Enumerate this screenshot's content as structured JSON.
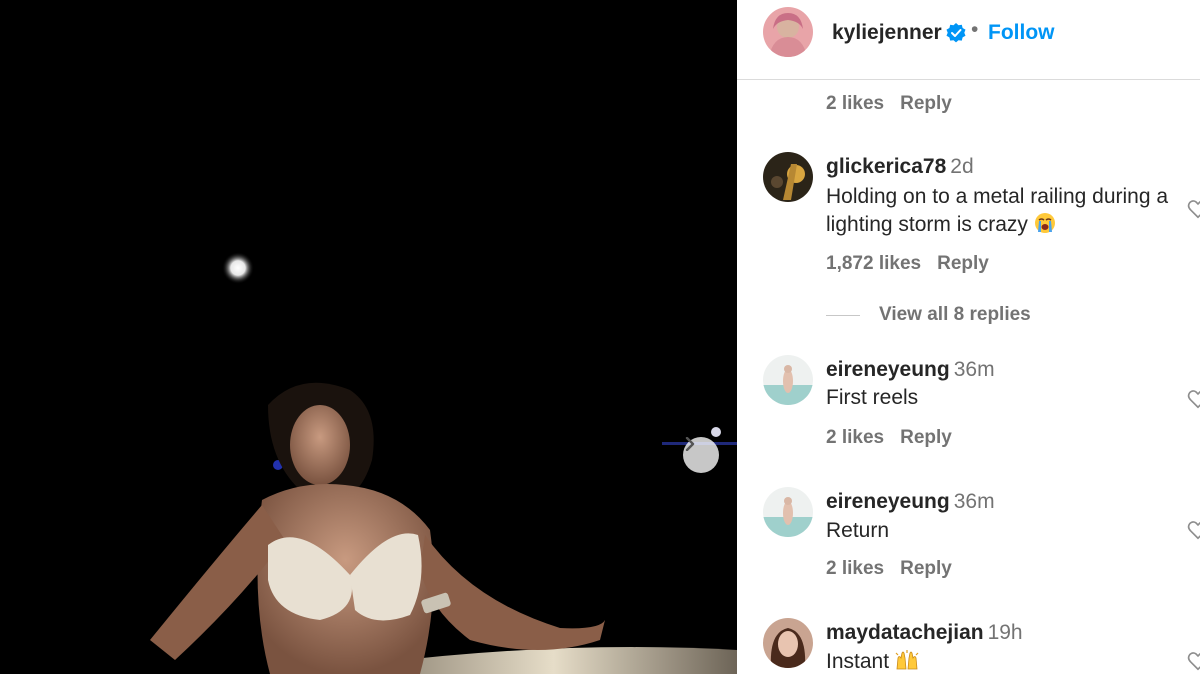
{
  "post": {
    "author": "kyliejenner",
    "follow_label": "Follow",
    "separator": "•"
  },
  "first_meta": {
    "likes": "2 likes",
    "reply": "Reply"
  },
  "comments": [
    {
      "username": "glickerica78",
      "time": "2d",
      "text": "Holding on to a metal railing during a lighting storm is crazy",
      "emoji": "loudly-crying-face",
      "likes": "1,872 likes",
      "reply": "Reply",
      "view_replies": "View all 8 replies"
    },
    {
      "username": "eireneyeung",
      "time": "36m",
      "text": "First reels",
      "likes": "2 likes",
      "reply": "Reply"
    },
    {
      "username": "eireneyeung",
      "time": "36m",
      "text": "Return",
      "likes": "2 likes",
      "reply": "Reply"
    },
    {
      "username": "maydatachejian",
      "time": "19h",
      "text": "Instant",
      "emoji": "raising-hands"
    }
  ],
  "icons": {
    "verified": "verified-badge-icon",
    "next": "chevron-right-icon",
    "like": "heart-outline-icon"
  },
  "colors": {
    "accent": "#0095f6",
    "verified": "#0095f6",
    "secondary_text": "#737373",
    "primary_text": "#262626",
    "media_background": "#000000"
  }
}
